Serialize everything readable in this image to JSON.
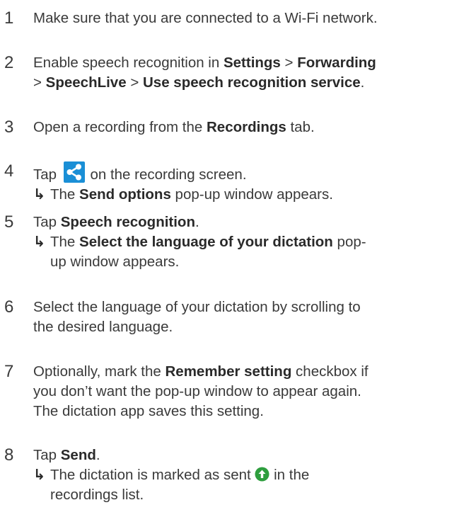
{
  "steps": [
    {
      "num": "1",
      "t1": "Make sure that you are connected to a Wi-Fi network."
    },
    {
      "num": "2",
      "t1": "Enable speech recognition in ",
      "b1": "Settings",
      "t2": " > ",
      "b2": "Forwarding",
      "t3": "> ",
      "b3": "SpeechLive",
      "t4": " > ",
      "b4": "Use speech recognition service",
      "t5": "."
    },
    {
      "num": "3",
      "t1": "Open a recording from the ",
      "b1": "Recordings",
      "t2": " tab."
    },
    {
      "num": "4",
      "t1": "Tap ",
      "icon": "share-icon",
      "t2": " on the recording screen.",
      "arrow": "↳",
      "r1": "The ",
      "rb1": "Send options",
      "r2": " pop-up window appears."
    },
    {
      "num": "5",
      "t1": "Tap ",
      "b1": "Speech recognition",
      "t2": ".",
      "arrow": "↳",
      "r1": "The ",
      "rb1": "Select the language of your dictation",
      "r2": " pop-",
      "r3": "up window appears."
    },
    {
      "num": "6",
      "t1": "Select the language of your dictation by scrolling to",
      "t2": "the desired language."
    },
    {
      "num": "7",
      "t1": "Optionally, mark the ",
      "b1": "Remember setting",
      "t2": " checkbox if",
      "t3": "you don’t want the pop-up window to appear again.",
      "t4": "The dictation app saves this setting."
    },
    {
      "num": "8",
      "t1": "Tap ",
      "b1": "Send",
      "t2": ".",
      "arrow": "↳",
      "r1": "The dictation is marked as sent ",
      "icon": "sent-arrow-icon",
      "r2": " in the",
      "r3": "recordings list."
    }
  ],
  "colors": {
    "text": "#3a3a3a",
    "share_icon_bg": "#1a8fd6",
    "sent_icon": "#2e9e3e"
  }
}
